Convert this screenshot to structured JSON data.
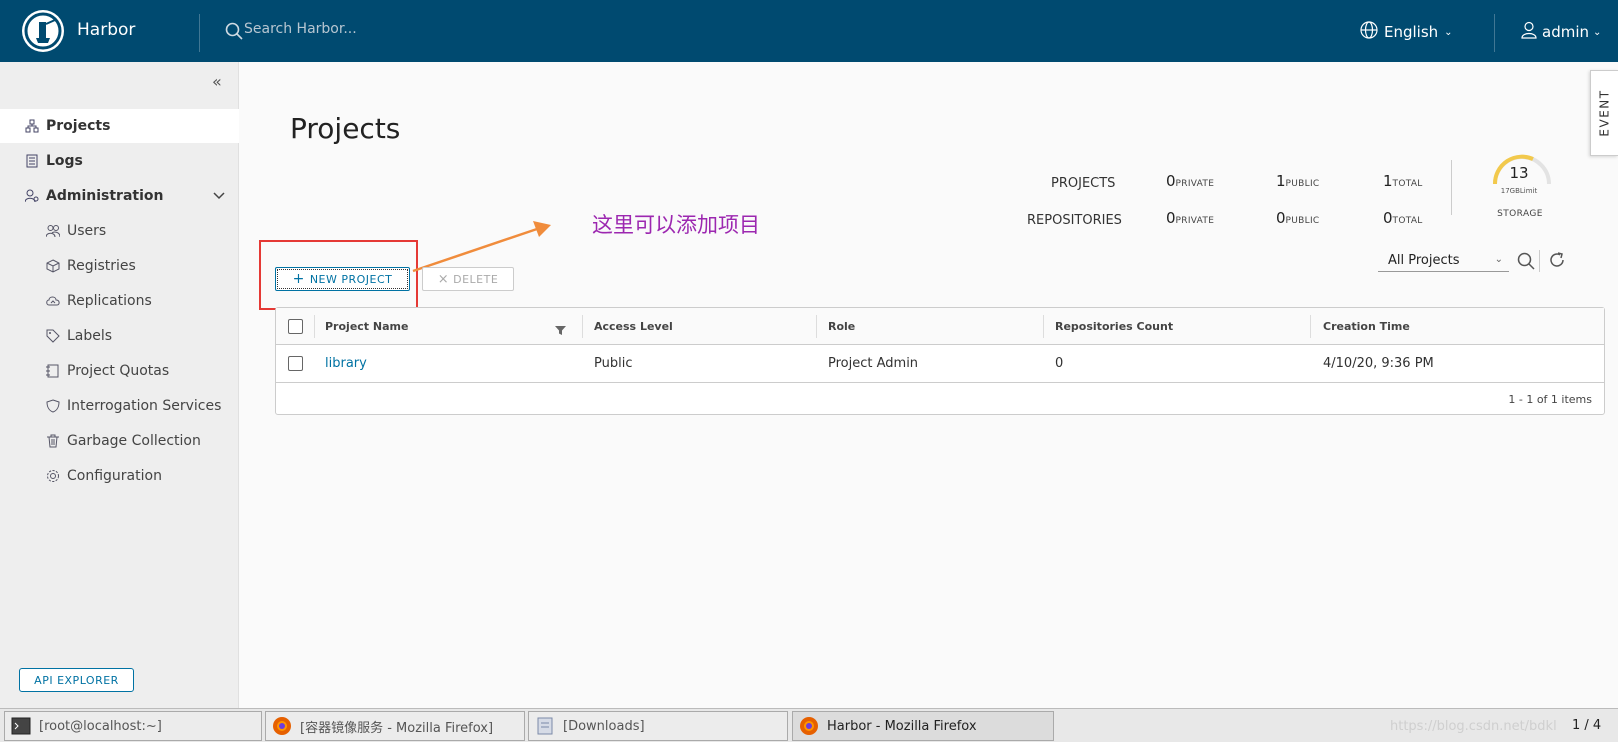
{
  "header": {
    "brand": "Harbor",
    "search_placeholder": "Search Harbor...",
    "language": "English",
    "user": "admin"
  },
  "sidebar": {
    "items": [
      {
        "label": "Projects",
        "icon": "projects-icon"
      },
      {
        "label": "Logs",
        "icon": "logs-icon"
      },
      {
        "label": "Administration",
        "icon": "administration-icon"
      }
    ],
    "admin_items": [
      {
        "label": "Users",
        "icon": "users-icon"
      },
      {
        "label": "Registries",
        "icon": "registries-icon"
      },
      {
        "label": "Replications",
        "icon": "replications-icon"
      },
      {
        "label": "Labels",
        "icon": "labels-icon"
      },
      {
        "label": "Project Quotas",
        "icon": "project-quotas-icon"
      },
      {
        "label": "Interrogation Services",
        "icon": "interrogation-services-icon"
      },
      {
        "label": "Garbage Collection",
        "icon": "garbage-collection-icon"
      },
      {
        "label": "Configuration",
        "icon": "configuration-icon"
      }
    ],
    "api_explorer": "API EXPLORER"
  },
  "main": {
    "title": "Projects",
    "stats": {
      "projects_label": "PROJECTS",
      "repositories_label": "REPOSITORIES",
      "private_label": "PRIVATE",
      "public_label": "PUBLIC",
      "total_label": "TOTAL",
      "projects_private": "0",
      "projects_public": "1",
      "projects_total": "1",
      "repos_private": "0",
      "repos_public": "0",
      "repos_total": "0",
      "storage_value": "13",
      "storage_limit": "17GBLimit",
      "storage_label": "STORAGE"
    },
    "annotation": "这里可以添加项目",
    "new_project": "NEW PROJECT",
    "delete": "DELETE",
    "filter": "All Projects",
    "columns": [
      "Project Name",
      "Access Level",
      "Role",
      "Repositories Count",
      "Creation Time"
    ],
    "rows": [
      {
        "name": "library",
        "access": "Public",
        "role": "Project Admin",
        "repos": "0",
        "created": "4/10/20, 9:36 PM"
      }
    ],
    "footer": "1 - 1 of 1 items"
  },
  "event_tab": "EVENT",
  "taskbar": {
    "tasks": [
      {
        "label": "[root@localhost:~]",
        "icon": "terminal-icon"
      },
      {
        "label": "[容器镜像服务 - Mozilla Firefox]",
        "icon": "firefox-icon"
      },
      {
        "label": "[Downloads]",
        "icon": "folder-icon"
      },
      {
        "label": "Harbor - Mozilla Firefox",
        "icon": "firefox-icon"
      }
    ],
    "pager": "1 / 4",
    "watermark": "https://blog.csdn.net/bdkl"
  },
  "colors": {
    "header_bg": "#004a70",
    "link": "#0072a3",
    "annotation": "#9c27b0",
    "highlight_box": "#e53935",
    "arrow": "#f08c3c"
  }
}
